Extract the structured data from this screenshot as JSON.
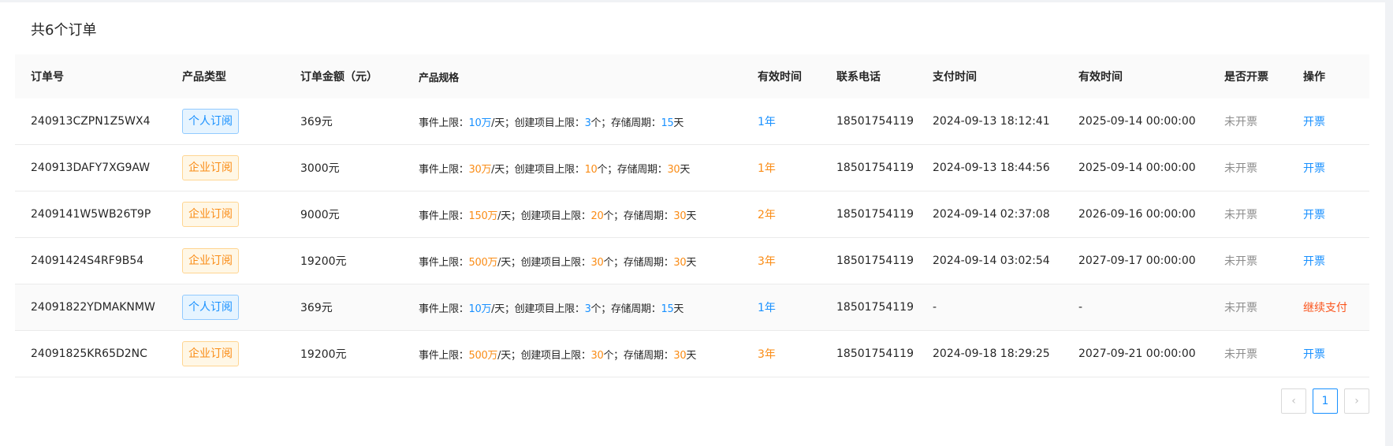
{
  "header": {
    "title": "共6个订单"
  },
  "table": {
    "columns": [
      "订单号",
      "产品类型",
      "订单金额（元）",
      "产品规格",
      "有效时间",
      "联系电话",
      "支付时间",
      "有效时间",
      "是否开票",
      "操作"
    ],
    "spec_labels": {
      "event": "事件上限：",
      "per_day": "/天；",
      "project": "创建项目上限：",
      "count_unit": "个；",
      "storage": "存储周期：",
      "day_unit": "天"
    },
    "rows": [
      {
        "order_id": "240913CZPN1Z5WX4",
        "type": "个人订阅",
        "type_kind": "personal",
        "amount": "369元",
        "event_limit": "10万",
        "project_limit": "3",
        "storage_days": "15",
        "duration": "1年",
        "phone": "18501754119",
        "paid_at": "2024-09-13 18:12:41",
        "valid_until": "2025-09-14 00:00:00",
        "invoice": "未开票",
        "action": "开票",
        "action_kind": "invoice"
      },
      {
        "order_id": "240913DAFY7XG9AW",
        "type": "企业订阅",
        "type_kind": "enterprise",
        "amount": "3000元",
        "event_limit": "30万",
        "project_limit": "10",
        "storage_days": "30",
        "duration": "1年",
        "phone": "18501754119",
        "paid_at": "2024-09-13 18:44:56",
        "valid_until": "2025-09-14 00:00:00",
        "invoice": "未开票",
        "action": "开票",
        "action_kind": "invoice"
      },
      {
        "order_id": "2409141W5WB26T9P",
        "type": "企业订阅",
        "type_kind": "enterprise",
        "amount": "9000元",
        "event_limit": "150万",
        "project_limit": "20",
        "storage_days": "30",
        "duration": "2年",
        "phone": "18501754119",
        "paid_at": "2024-09-14 02:37:08",
        "valid_until": "2026-09-16 00:00:00",
        "invoice": "未开票",
        "action": "开票",
        "action_kind": "invoice"
      },
      {
        "order_id": "24091424S4RF9B54",
        "type": "企业订阅",
        "type_kind": "enterprise",
        "amount": "19200元",
        "event_limit": "500万",
        "project_limit": "30",
        "storage_days": "30",
        "duration": "3年",
        "phone": "18501754119",
        "paid_at": "2024-09-14 03:02:54",
        "valid_until": "2027-09-17 00:00:00",
        "invoice": "未开票",
        "action": "开票",
        "action_kind": "invoice"
      },
      {
        "order_id": "24091822YDMAKNMW",
        "type": "个人订阅",
        "type_kind": "personal",
        "amount": "369元",
        "event_limit": "10万",
        "project_limit": "3",
        "storage_days": "15",
        "duration": "1年",
        "phone": "18501754119",
        "paid_at": "-",
        "valid_until": "-",
        "invoice": "未开票",
        "action": "继续支付",
        "action_kind": "pay"
      },
      {
        "order_id": "24091825KR65D2NC",
        "type": "企业订阅",
        "type_kind": "enterprise",
        "amount": "19200元",
        "event_limit": "500万",
        "project_limit": "30",
        "storage_days": "30",
        "duration": "3年",
        "phone": "18501754119",
        "paid_at": "2024-09-18 18:29:25",
        "valid_until": "2027-09-21 00:00:00",
        "invoice": "未开票",
        "action": "开票",
        "action_kind": "invoice"
      }
    ]
  },
  "pagination": {
    "prev_icon": "chevron-left-icon",
    "prev_glyph": "‹",
    "current_page": "1",
    "next_icon": "chevron-right-icon",
    "next_glyph": "›"
  },
  "colors": {
    "personal": "#1890ff",
    "enterprise": "#fa8c16",
    "pay_action": "#fa541c",
    "link": "#1890ff"
  }
}
